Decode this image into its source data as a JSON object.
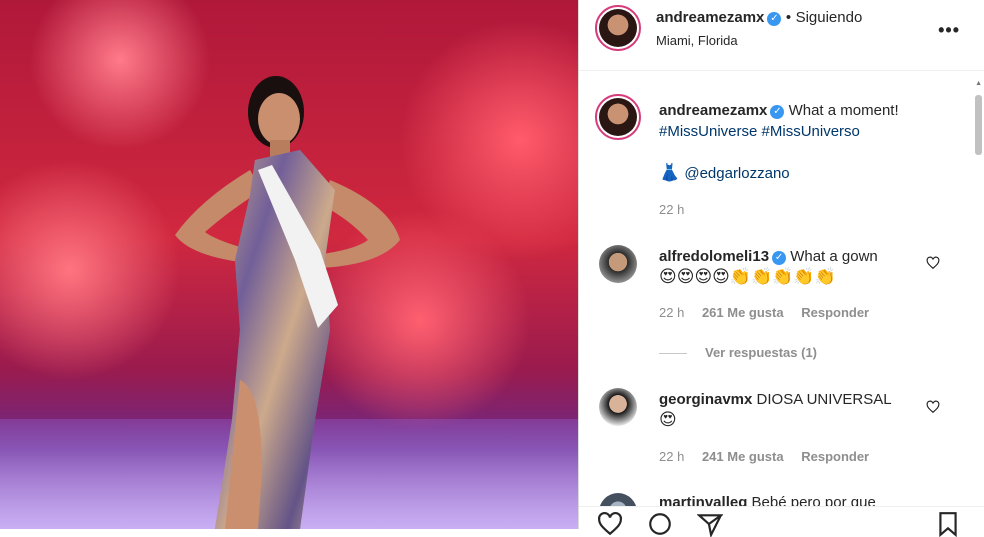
{
  "post": {
    "author": "andreamezamx",
    "verified_mark": "✓",
    "follow_separator": "•",
    "follow_label": "Siguiendo",
    "location": "Miami, Florida",
    "more_icon": "more-options-icon",
    "more_label": "•••"
  },
  "caption": {
    "username": "andreamezamx",
    "text": "What a moment!",
    "hashtags": "#MissUniverse #MissUniverso",
    "dress_emoji": "👗",
    "mention": "@edgarlozzano",
    "time": "22 h"
  },
  "comments": [
    {
      "username": "alfredolomeli13",
      "verified": true,
      "text": "What a gown",
      "emojis": "😍😍😍😍👏👏👏👏👏",
      "time": "22 h",
      "likes": "261 Me gusta",
      "reply": "Responder",
      "view_replies": "Ver respuestas (1)"
    },
    {
      "username": "georginavmx",
      "verified": false,
      "text": "DIOSA UNIVERSAL",
      "emojis": "😍",
      "time": "22 h",
      "likes": "241 Me gusta",
      "reply": "Responder"
    },
    {
      "username": "martinvalleg",
      "text": "Bebé pero por que"
    }
  ],
  "colors": {
    "accent_link": "#00376b",
    "verified_blue": "#3897f0",
    "story_ring": "#d63c7c"
  }
}
